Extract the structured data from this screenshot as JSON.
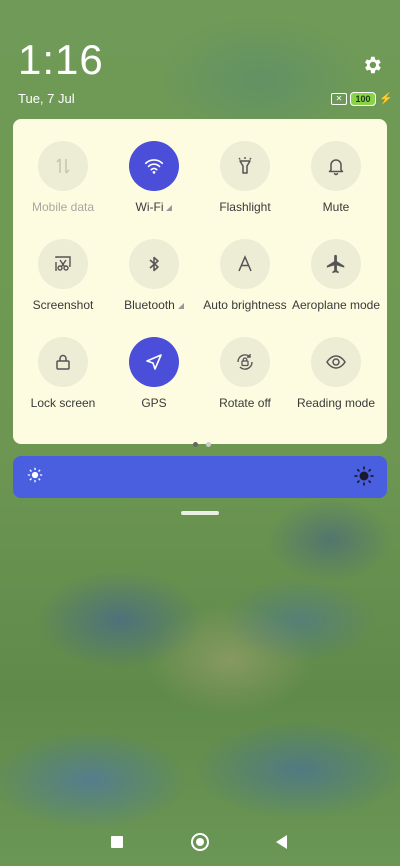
{
  "status": {
    "time": "1:16",
    "date": "Tue, 7 Jul",
    "battery_level": "100",
    "battery_color": "#8ad24a",
    "icons": [
      "gear-icon",
      "no-sim-icon",
      "battery-icon",
      "charging-bolt-icon"
    ]
  },
  "quick_settings": {
    "tiles": [
      {
        "label": "Mobile data",
        "icon": "mobile-data-icon",
        "active": false,
        "disabled": true
      },
      {
        "label": "Wi-Fi",
        "icon": "wifi-icon",
        "active": true,
        "expandable": true
      },
      {
        "label": "Flashlight",
        "icon": "flashlight-icon",
        "active": false
      },
      {
        "label": "Mute",
        "icon": "bell-icon",
        "active": false
      },
      {
        "label": "Screenshot",
        "icon": "scissors-icon",
        "active": false
      },
      {
        "label": "Bluetooth",
        "icon": "bluetooth-icon",
        "active": false,
        "expandable": true
      },
      {
        "label": "Auto brightness",
        "icon": "auto-brightness-icon",
        "active": false
      },
      {
        "label": "Aeroplane mode",
        "icon": "airplane-icon",
        "active": false
      },
      {
        "label": "Lock screen",
        "icon": "lock-icon",
        "active": false
      },
      {
        "label": "GPS",
        "icon": "location-arrow-icon",
        "active": true
      },
      {
        "label": "Rotate off",
        "icon": "rotate-lock-icon",
        "active": false
      },
      {
        "label": "Reading mode",
        "icon": "eye-icon",
        "active": false
      }
    ],
    "page_indicator": {
      "pages": 2,
      "current": 1
    },
    "active_color": "#4a4ed9"
  },
  "brightness": {
    "color": "#4a5ee0",
    "icons": [
      "sun-low-icon",
      "sun-high-icon"
    ]
  },
  "navbar": {
    "buttons": [
      "recents-button",
      "home-button",
      "back-button"
    ]
  }
}
